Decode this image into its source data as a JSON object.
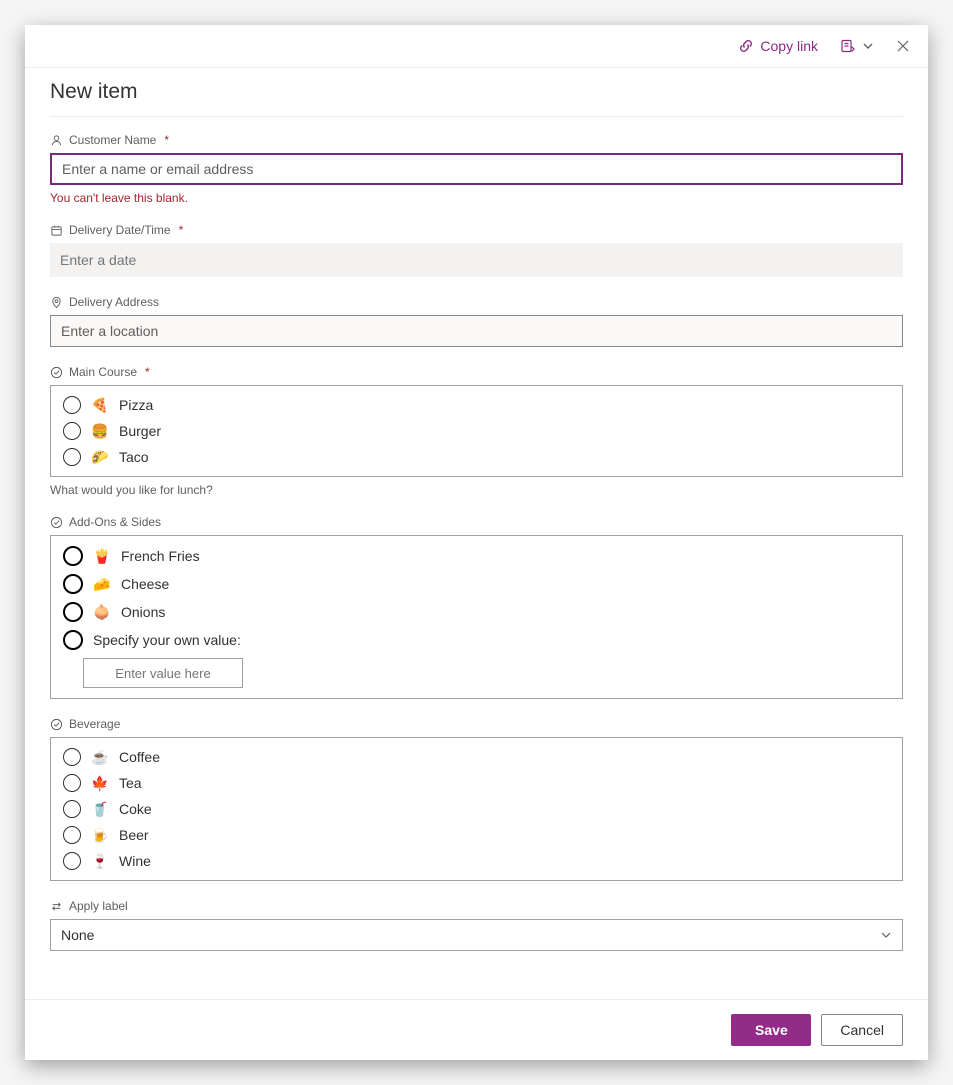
{
  "header": {
    "copy_link": "Copy link",
    "close_label": "Close"
  },
  "title": "New item",
  "fields": {
    "customer": {
      "label": "Customer Name",
      "placeholder": "Enter a name or email address",
      "error": "You can't leave this blank.",
      "required": true
    },
    "delivery_date": {
      "label": "Delivery Date/Time",
      "placeholder": "Enter a date",
      "required": true
    },
    "address": {
      "label": "Delivery Address",
      "placeholder": "Enter a location"
    },
    "main_course": {
      "label": "Main Course",
      "required": true,
      "options": [
        {
          "emoji": "🍕",
          "text": "Pizza"
        },
        {
          "emoji": "🍔",
          "text": "Burger"
        },
        {
          "emoji": "🌮",
          "text": "Taco"
        }
      ],
      "description": "What would you like for lunch?"
    },
    "addons": {
      "label": "Add-Ons & Sides",
      "options": [
        {
          "emoji": "🍟",
          "text": "French Fries"
        },
        {
          "emoji": "🧀",
          "text": "Cheese"
        },
        {
          "emoji": "🧅",
          "text": "Onions"
        }
      ],
      "specify_label": "Specify your own value:",
      "specify_placeholder": "Enter value here"
    },
    "beverage": {
      "label": "Beverage",
      "options": [
        {
          "emoji": "☕",
          "text": "Coffee"
        },
        {
          "emoji": "🍁",
          "text": "Tea"
        },
        {
          "emoji": "🥤",
          "text": "Coke"
        },
        {
          "emoji": "🍺",
          "text": "Beer"
        },
        {
          "emoji": "🍷",
          "text": "Wine"
        }
      ]
    },
    "apply_label": {
      "label": "Apply label",
      "value": "None"
    }
  },
  "buttons": {
    "save": "Save",
    "cancel": "Cancel"
  },
  "required_marker": "*"
}
